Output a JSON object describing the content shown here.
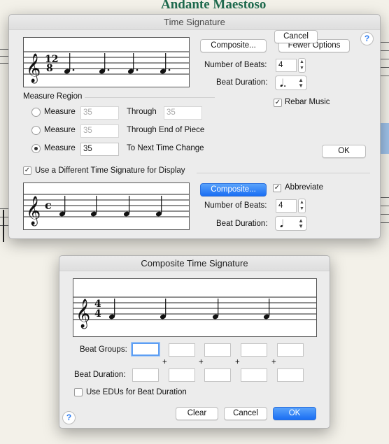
{
  "background": {
    "piece_title": "Andante Maestoso"
  },
  "time_signature_dialog": {
    "title": "Time Signature",
    "preview_time_signature": {
      "top": "12",
      "bottom": "8"
    },
    "composite_button": "Composite...",
    "fewer_options_button": "Fewer Options",
    "number_of_beats_label": "Number of Beats:",
    "number_of_beats_value": "4",
    "beat_duration_label": "Beat Duration:",
    "beat_duration_value": "𝅘𝅥.",
    "measure_region_label": "Measure Region",
    "rows": [
      {
        "label": "Measure",
        "value": "35",
        "suffix": "Through",
        "through_value": "35",
        "selected": false
      },
      {
        "label": "Measure",
        "value": "35",
        "suffix": "Through End of Piece",
        "selected": false
      },
      {
        "label": "Measure",
        "value": "35",
        "suffix": "To Next Time Change",
        "selected": true
      }
    ],
    "rebar_music_label": "Rebar Music",
    "rebar_music_checked": true,
    "cancel_button": "Cancel",
    "ok_button": "OK",
    "different_display_label": "Use a Different Time Signature for Display",
    "different_display_checked": true,
    "display_preview_symbol": "c",
    "display_composite_button": "Composite...",
    "abbreviate_label": "Abbreviate",
    "abbreviate_checked": true,
    "display_number_of_beats_label": "Number of Beats:",
    "display_number_of_beats_value": "4",
    "display_beat_duration_label": "Beat Duration:",
    "display_beat_duration_value": "𝅘𝅥",
    "help_label": "?"
  },
  "composite_dialog": {
    "title": "Composite Time Signature",
    "preview_time_signature": {
      "top": "4",
      "bottom": "4"
    },
    "beat_groups_label": "Beat Groups:",
    "beat_groups_values": [
      "",
      "",
      "",
      "",
      ""
    ],
    "plus_sign": "+",
    "beat_duration_label": "Beat Duration:",
    "beat_duration_values": [
      "",
      "",
      "",
      "",
      ""
    ],
    "use_edus_label": "Use EDUs for Beat Duration",
    "use_edus_checked": false,
    "clear_button": "Clear",
    "cancel_button": "Cancel",
    "ok_button": "OK",
    "help_label": "?"
  }
}
